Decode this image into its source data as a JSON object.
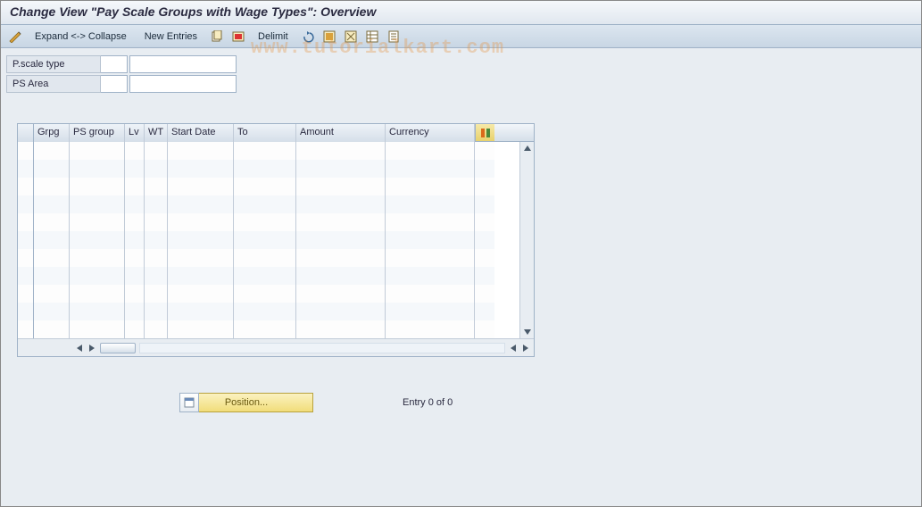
{
  "title": "Change View \"Pay Scale Groups with Wage Types\": Overview",
  "toolbar": {
    "expand_collapse": "Expand <-> Collapse",
    "new_entries": "New Entries",
    "delimit": "Delimit"
  },
  "form": {
    "pscale_type_label": "P.scale type",
    "pscale_type_code": "",
    "pscale_type_desc": "",
    "ps_area_label": "PS Area",
    "ps_area_code": "",
    "ps_area_desc": ""
  },
  "table": {
    "columns": {
      "grpg": "Grpg",
      "ps_group": "PS group",
      "lv": "Lv",
      "wt": "WT",
      "start_date": "Start Date",
      "to": "To",
      "amount": "Amount",
      "currency": "Currency"
    },
    "rows": [
      {
        "grpg": "",
        "ps_group": "",
        "lv": "",
        "wt": "",
        "start_date": "",
        "to": "",
        "amount": "",
        "currency": ""
      },
      {
        "grpg": "",
        "ps_group": "",
        "lv": "",
        "wt": "",
        "start_date": "",
        "to": "",
        "amount": "",
        "currency": ""
      },
      {
        "grpg": "",
        "ps_group": "",
        "lv": "",
        "wt": "",
        "start_date": "",
        "to": "",
        "amount": "",
        "currency": ""
      },
      {
        "grpg": "",
        "ps_group": "",
        "lv": "",
        "wt": "",
        "start_date": "",
        "to": "",
        "amount": "",
        "currency": ""
      },
      {
        "grpg": "",
        "ps_group": "",
        "lv": "",
        "wt": "",
        "start_date": "",
        "to": "",
        "amount": "",
        "currency": ""
      },
      {
        "grpg": "",
        "ps_group": "",
        "lv": "",
        "wt": "",
        "start_date": "",
        "to": "",
        "amount": "",
        "currency": ""
      },
      {
        "grpg": "",
        "ps_group": "",
        "lv": "",
        "wt": "",
        "start_date": "",
        "to": "",
        "amount": "",
        "currency": ""
      },
      {
        "grpg": "",
        "ps_group": "",
        "lv": "",
        "wt": "",
        "start_date": "",
        "to": "",
        "amount": "",
        "currency": ""
      },
      {
        "grpg": "",
        "ps_group": "",
        "lv": "",
        "wt": "",
        "start_date": "",
        "to": "",
        "amount": "",
        "currency": ""
      },
      {
        "grpg": "",
        "ps_group": "",
        "lv": "",
        "wt": "",
        "start_date": "",
        "to": "",
        "amount": "",
        "currency": ""
      },
      {
        "grpg": "",
        "ps_group": "",
        "lv": "",
        "wt": "",
        "start_date": "",
        "to": "",
        "amount": "",
        "currency": ""
      }
    ]
  },
  "footer": {
    "position_label": "Position...",
    "entry_text": "Entry 0 of 0"
  },
  "watermark": "www.tutorialkart.com"
}
